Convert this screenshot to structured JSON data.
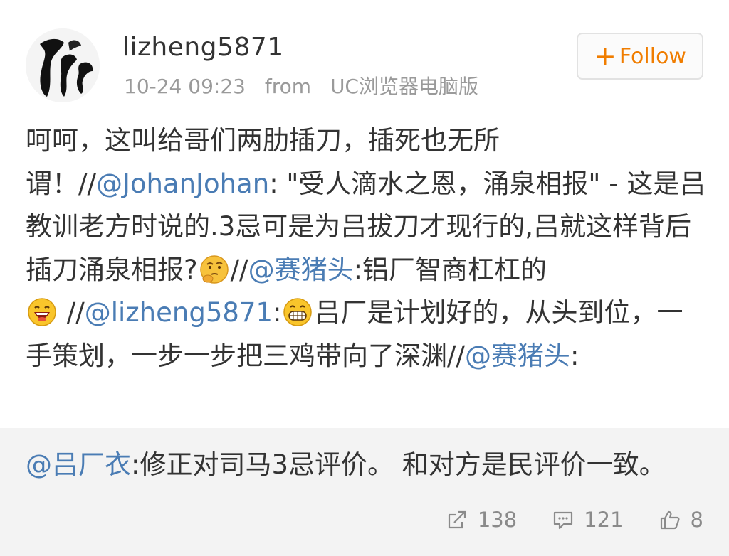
{
  "post": {
    "username": "lizheng5871",
    "time": "10-24 09:23",
    "from_label": "from",
    "source": "UC浏览器电脑版",
    "follow_label": "Follow",
    "follow_plus": "+",
    "content": {
      "seg1": "呵呵，这叫给哥们两肋插刀，插死也无所谓！//",
      "mention1": "@JohanJohan",
      "seg2": ": \"受人滴水之恩，涌泉相报\" - 这是吕教训老方时说的.3忌可是为吕拔刀才现行的,吕就这样背后插刀涌泉相报?",
      "seg3": "//",
      "mention2": "@赛猪头",
      "seg4": ":铝厂智商杠杠的",
      "seg5": " //",
      "mention3": "@lizheng5871",
      "seg6": ":",
      "seg7": "吕厂是计划好的，从头到位，一手策划，一步一步把三鸡带向了深渊//",
      "mention4": "@赛猪头",
      "seg8": ":"
    }
  },
  "repost": {
    "mention": "@吕厂衣",
    "text": ":修正对司马3忌评价。 和对方是民评价一致。"
  },
  "actions": {
    "repost_count": "138",
    "comment_count": "121",
    "like_count": "8"
  },
  "icons": [
    "avatar-image",
    "plus-icon",
    "thinking-emoji",
    "laughing-emoji",
    "grinning-emoji",
    "repost-icon",
    "comment-icon",
    "like-icon"
  ],
  "colors": {
    "mention": "#4a7cb4",
    "follow": "#f07d00",
    "meta": "#9a9a9a",
    "repost_bg": "#f3f3f3"
  }
}
